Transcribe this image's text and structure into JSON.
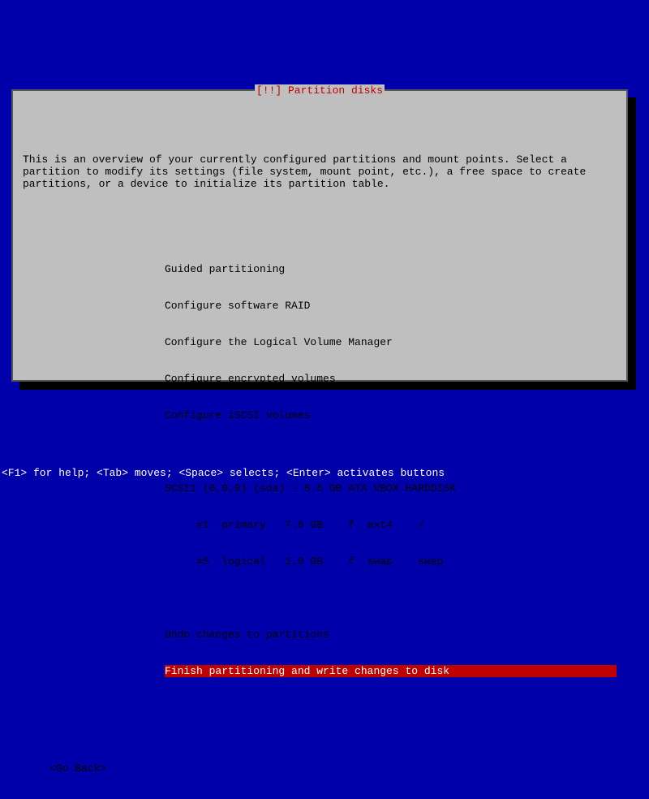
{
  "title": "[!!] Partition disks",
  "intro": "This is an overview of your currently configured partitions and mount points. Select a partition to modify its settings (file system, mount point, etc.), a free space to create partitions, or a device to initialize its partition table.",
  "menu_top": [
    "Guided partitioning",
    "Configure software RAID",
    "Configure the Logical Volume Manager",
    "Configure encrypted volumes",
    "Configure iSCSI volumes"
  ],
  "disk": "SCSI1 (0,0,0) (sda) - 8.6 GB ATA VBOX HARDDISK",
  "partitions": [
    "     #1  primary   7.6 GB    f  ext4    /",
    "     #5  logical   1.0 GB    f  swap    swap"
  ],
  "menu_bottom": [
    {
      "label": "Undo changes to partitions",
      "selected": false
    },
    {
      "label": "Finish partitioning and write changes to disk ",
      "selected": true
    }
  ],
  "go_back": "<Go Back>",
  "help_bar": "<F1> for help; <Tab> moves; <Space> selects; <Enter> activates buttons"
}
